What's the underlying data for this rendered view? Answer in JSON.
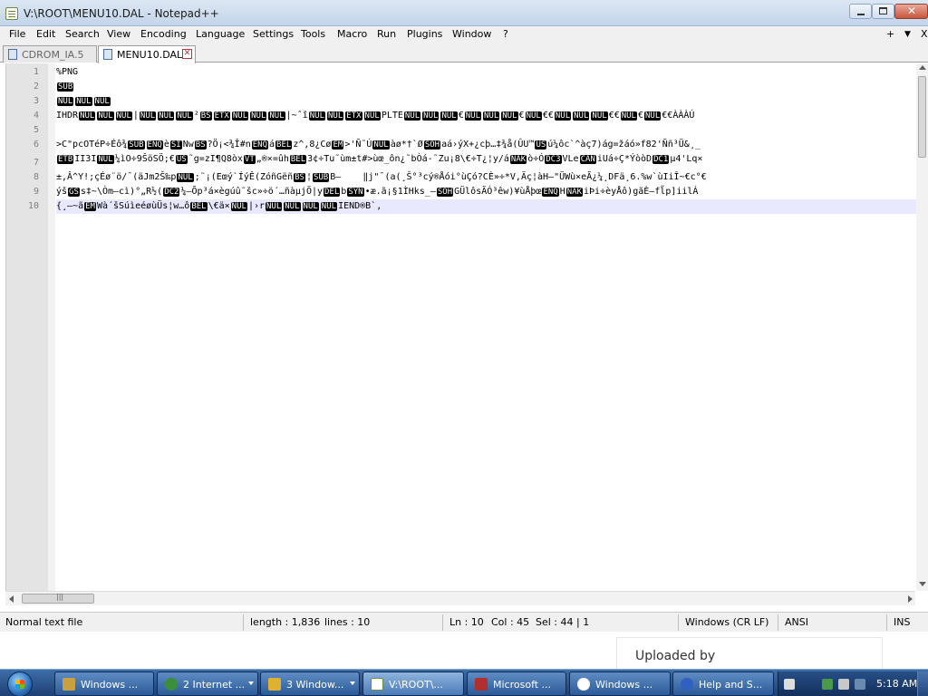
{
  "window": {
    "title": "V:\\ROOT\\MENU10.DAL - Notepad++"
  },
  "menu": {
    "items": [
      "File",
      "Edit",
      "Search",
      "View",
      "Encoding",
      "Language",
      "Settings",
      "Tools",
      "Macro",
      "Run",
      "Plugins",
      "Window",
      "?"
    ],
    "right_plus": "+",
    "right_arrow": "▼",
    "right_close": "X"
  },
  "tabs": [
    {
      "label": "CDROM_IA.5",
      "active": false
    },
    {
      "label": "MENU10.DAL",
      "active": true
    }
  ],
  "editor": {
    "line_numbers": [
      "1",
      "2",
      "3",
      "4",
      "5",
      "6",
      "7",
      "8",
      "9",
      "10"
    ],
    "lines": [
      [
        {
          "t": "%PNG"
        }
      ],
      [
        {
          "c": "SUB"
        }
      ],
      [
        {
          "c": "NUL"
        },
        {
          "c": "NUL"
        },
        {
          "c": "NUL"
        }
      ],
      [
        {
          "t": "IHDR"
        },
        {
          "c": "NUL"
        },
        {
          "c": "NUL"
        },
        {
          "c": "NUL"
        },
        {
          "t": "|"
        },
        {
          "c": "NUL"
        },
        {
          "c": "NUL"
        },
        {
          "c": "NUL"
        },
        {
          "t": "²"
        },
        {
          "c": "BS"
        },
        {
          "c": "ETX"
        },
        {
          "c": "NUL"
        },
        {
          "c": "NUL"
        },
        {
          "c": "NUL"
        },
        {
          "t": "|~ˆî"
        },
        {
          "c": "NUL"
        },
        {
          "c": "NUL"
        },
        {
          "c": "ETX"
        },
        {
          "c": "NUL"
        },
        {
          "t": "PLTE"
        },
        {
          "c": "NUL"
        },
        {
          "c": "NUL"
        },
        {
          "c": "NUL"
        },
        {
          "t": "€"
        },
        {
          "c": "NUL"
        },
        {
          "c": "NUL"
        },
        {
          "c": "NUL"
        },
        {
          "t": "€"
        },
        {
          "c": "NUL"
        },
        {
          "t": "€€"
        },
        {
          "c": "NUL"
        },
        {
          "c": "NUL"
        },
        {
          "c": "NUL"
        },
        {
          "t": "€€"
        },
        {
          "c": "NUL"
        },
        {
          "t": "€"
        },
        {
          "c": "NUL"
        },
        {
          "t": "€€ÀÀÀÚ"
        }
      ],
      [],
      [
        {
          "t": ">C\"pcOTéP÷Éô¾"
        },
        {
          "c": "SUB"
        },
        {
          "c": "ENQ"
        },
        {
          "t": "è"
        },
        {
          "c": "SI"
        },
        {
          "t": "Nw"
        },
        {
          "c": "BS"
        },
        {
          "t": "?Ö¡<¾Î#n"
        },
        {
          "c": "ENQ"
        },
        {
          "t": "á"
        },
        {
          "c": "BEL"
        },
        {
          "t": "z^,8¿Cø"
        },
        {
          "c": "EM"
        },
        {
          "t": ">'Ñ˜Ú"
        },
        {
          "c": "NUL"
        },
        {
          "t": "àø*†`Ø"
        },
        {
          "c": "SOH"
        },
        {
          "t": "aá›ýX+¿cþ…‡¾å(ÛU™"
        },
        {
          "c": "US"
        },
        {
          "t": "ú¼ôc`^àç7)ág=žáó»f82'Ññ³Ü&¸_"
        }
      ],
      [
        {
          "c": "ETB"
        },
        {
          "t": "II3I"
        },
        {
          "c": "NUL"
        },
        {
          "t": "¼ìO÷9ŠöSÖ;€"
        },
        {
          "c": "US"
        },
        {
          "t": "˜g=zI¶Q8òx"
        },
        {
          "c": "VT"
        },
        {
          "t": "„®×=ûh"
        },
        {
          "c": "BEL"
        },
        {
          "t": "3¢÷Tu˜ùm±t#>ùœ_ôn¿˜bÒá-˜Zu¡8\\€÷T¿¦y/á"
        },
        {
          "c": "NAK"
        },
        {
          "t": "ò÷Ó"
        },
        {
          "c": "DC3"
        },
        {
          "t": "VLe"
        },
        {
          "c": "CAN"
        },
        {
          "t": "iUá÷Ç*ÝòòD"
        },
        {
          "c": "DC1"
        },
        {
          "t": "µ4'Lq×"
        }
      ],
      [
        {
          "t": "±,Â^Y!;çÉø¨ö/¯(äJm2Š‰p"
        },
        {
          "c": "NUL"
        },
        {
          "t": ";˜¡(Eœý`ÍýÊ(ZóñGëñ"
        },
        {
          "c": "BS"
        },
        {
          "t": "¦"
        },
        {
          "c": "SUB"
        },
        {
          "t": "B–    ‖j\"¯(a(¸Š°³cý®Åói°ùÇó?CÈ»÷*V,Äç¦àH–\"ÜWù×eÃ¿¼¸DFä¸6.%w`ùIiÎ~€c°€"
        }
      ],
      [
        {
          "t": "ýš"
        },
        {
          "c": "GS"
        },
        {
          "t": "s‡~\\Òm–cì)°„R½("
        },
        {
          "c": "DC2"
        },
        {
          "t": "¼–Õp³á×ègúû˜šc»÷ö´…ñàµjÖ|y"
        },
        {
          "c": "DEL"
        },
        {
          "t": "b"
        },
        {
          "c": "SYN"
        },
        {
          "t": "•æ.ã¡§1ÌHks_–"
        },
        {
          "c": "SOH"
        },
        {
          "t": "GÜlôsÃÓ³êw)¥ùÅþœ"
        },
        {
          "c": "ENQ"
        },
        {
          "t": "H"
        },
        {
          "c": "NAK"
        },
        {
          "t": "iÞi÷èyÅô)gãÈ–fl̃p]iilÁ"
        }
      ],
      [
        {
          "t": "{¸–~ã"
        },
        {
          "c": "EM"
        },
        {
          "t": "Wà´šSúìeéøùÜs¦w…ô"
        },
        {
          "c": "BEL"
        },
        {
          "t": "\\€ä×"
        },
        {
          "c": "NUL"
        },
        {
          "t": "|›r"
        },
        {
          "c": "NUL"
        },
        {
          "c": "NUL"
        },
        {
          "c": "NUL"
        },
        {
          "c": "NUL"
        },
        {
          "t": "IEND®B`‚"
        }
      ]
    ]
  },
  "statusbar": {
    "file_type": "Normal text file",
    "length": "length : 1,836",
    "lines": "lines : 10",
    "ln": "Ln : 10",
    "col": "Col : 45",
    "sel": "Sel : 44 | 1",
    "eol": "Windows (CR LF)",
    "encoding": "ANSI",
    "mode": "INS"
  },
  "overlay": {
    "uploaded_by": "Uploaded by"
  },
  "taskbar": {
    "buttons": [
      {
        "label": "Windows ...",
        "icon_color": "#c8a040",
        "dropdown": false,
        "active": false
      },
      {
        "label": "2 Internet ...",
        "icon_color": "#3a8f3a",
        "dropdown": true,
        "active": false
      },
      {
        "label": "3 Window...",
        "icon_color": "#e0b030",
        "dropdown": true,
        "active": false
      },
      {
        "label": "V:\\ROOT\\...",
        "icon_color": "#ffffff",
        "dropdown": false,
        "active": true
      },
      {
        "label": "Microsoft ...",
        "icon_color": "#b03030",
        "dropdown": false,
        "active": false
      },
      {
        "label": "Windows ...",
        "icon_color": "#ffffff",
        "dropdown": false,
        "active": false
      },
      {
        "label": "Help and S...",
        "icon_color": "#3060c0",
        "dropdown": false,
        "active": false
      }
    ],
    "clock": "5:18 AM"
  },
  "colors": {
    "control_char_bg": "#000000",
    "current_line": "#e8e8ff",
    "gutter": "#e4e4e4"
  }
}
